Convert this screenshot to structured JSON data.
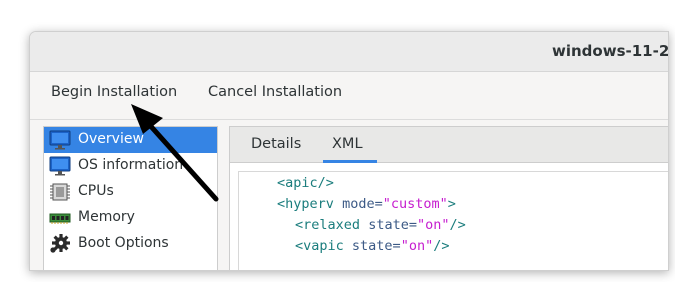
{
  "window": {
    "title": "windows-11-2"
  },
  "actions": {
    "begin_install": "Begin Installation",
    "cancel_install": "Cancel Installation"
  },
  "sidebar": {
    "items": [
      {
        "label": "Overview",
        "icon": "monitor-icon",
        "selected": true
      },
      {
        "label": "OS information",
        "icon": "monitor-icon",
        "selected": false
      },
      {
        "label": "CPUs",
        "icon": "cpu-icon",
        "selected": false
      },
      {
        "label": "Memory",
        "icon": "memory-icon",
        "selected": false
      },
      {
        "label": "Boot Options",
        "icon": "gear-icon",
        "selected": false
      }
    ]
  },
  "tabs": [
    {
      "label": "Details",
      "active": false
    },
    {
      "label": "XML",
      "active": true
    }
  ],
  "xml": {
    "line1": {
      "open": "<",
      "tag": "apic",
      "close": "/>"
    },
    "line2": {
      "open": "<",
      "tag": "hyperv",
      "attr": "mode=",
      "val": "\"custom\"",
      "close": ">"
    },
    "line3": {
      "open": "<",
      "tag": "relaxed",
      "attr": "state=",
      "val": "\"on\"",
      "close": "/>"
    },
    "line4": {
      "open": "<",
      "tag": "vapic",
      "attr": "state=",
      "val": "\"on\"",
      "close": "/>"
    }
  },
  "colors": {
    "accent": "#3584e4",
    "xml_tag": "#1b7d7d",
    "xml_attr": "#3c5a86",
    "xml_value": "#c61ecf"
  }
}
